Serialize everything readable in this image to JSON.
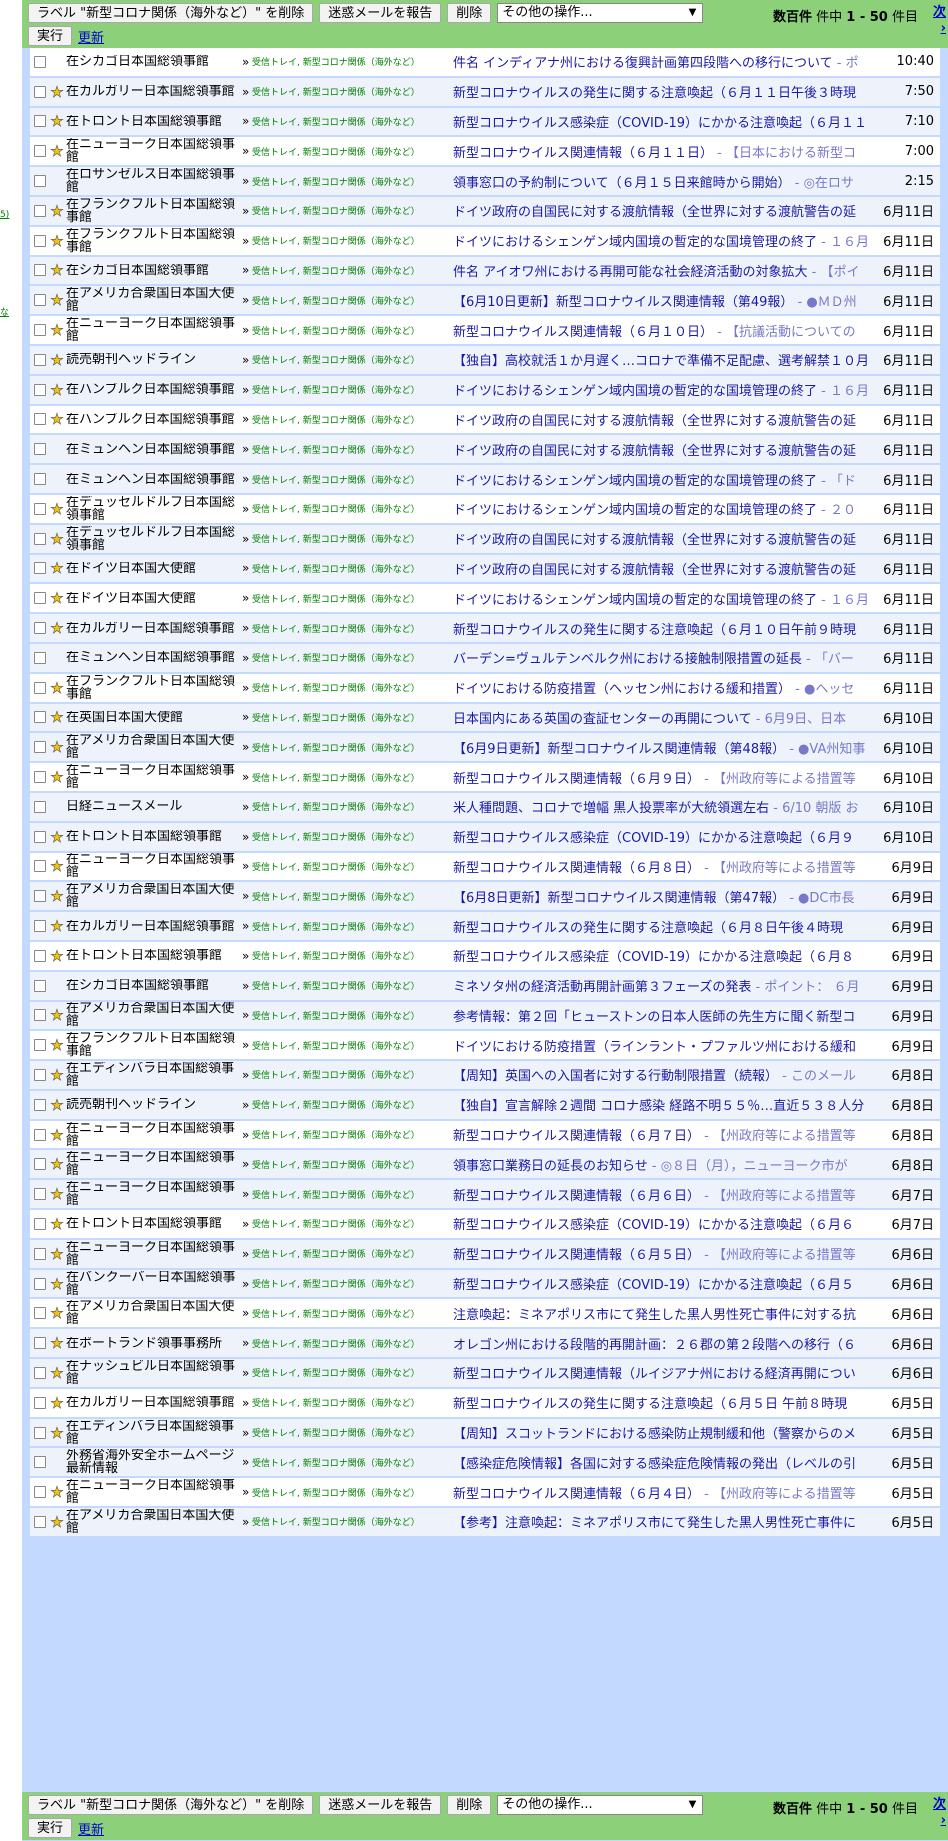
{
  "toolbar": {
    "remove_label_btn": "ラベル \"新型コロナ関係（海外など）\" を削除",
    "report_spam_btn": "迷惑メールを報告",
    "delete_btn": "削除",
    "more_actions": "その他の操作...",
    "execute_btn": "実行",
    "refresh_link": "更新",
    "count_prefix": "数百件",
    "count_mid": " 件中 ",
    "count_range": "1 - 50",
    "count_suffix": " 件目",
    "next_link": "次",
    "next_arrow": "›"
  },
  "left_fragments": [
    "5)",
    "な"
  ],
  "emails": [
    {
      "sender": "在シカゴ日本国総領事館",
      "starred": false,
      "subject": "件名 インディアナ州における復興計画第四段階への移行について",
      "snippet": " - ポ",
      "date": "10:40"
    },
    {
      "sender": "在カルガリー日本国総領事館",
      "starred": true,
      "subject": "新型コロナウイルスの発生に関する注意喚起（６月１１日午後３時現",
      "snippet": "",
      "date": "7:50"
    },
    {
      "sender": "在トロント日本国総領事館",
      "starred": true,
      "subject": "新型コロナウイルス感染症（COVID-19）にかかる注意喚起（６月１１",
      "snippet": "",
      "date": "7:10"
    },
    {
      "sender": "在ニューヨーク日本国総領事館",
      "starred": true,
      "subject": "新型コロナウイルス関連情報（６月１１日）",
      "snippet": " - 【日本における新型コ",
      "date": "7:00"
    },
    {
      "sender": "在ロサンゼルス日本国総領事館",
      "starred": false,
      "subject": "領事窓口の予約制について（６月１５日来館時から開始）",
      "snippet": " - ◎在ロサ",
      "date": "2:15"
    },
    {
      "sender": "在フランクフルト日本国総領事館",
      "starred": true,
      "subject": "ドイツ政府の自国民に対する渡航情報（全世界に対する渡航警告の延",
      "snippet": "",
      "date": "6月11日"
    },
    {
      "sender": "在フランクフルト日本国総領事館",
      "starred": true,
      "subject": "ドイツにおけるシェンゲン域内国境の暫定的な国境管理の終了",
      "snippet": " - １６月",
      "date": "6月11日"
    },
    {
      "sender": "在シカゴ日本国総領事館",
      "starred": true,
      "subject": "件名 アイオワ州における再開可能な社会経済活動の対象拡大",
      "snippet": " - 【ポイ",
      "date": "6月11日"
    },
    {
      "sender": "在アメリカ合衆国日本国大使館",
      "starred": true,
      "subject": "【6月10日更新】新型コロナウイルス関連情報（第49報）",
      "snippet": " - ●ＭＤ州",
      "date": "6月11日"
    },
    {
      "sender": "在ニューヨーク日本国総領事館",
      "starred": true,
      "subject": "新型コロナウイルス関連情報（６月１０日）",
      "snippet": " - 【抗議活動についての",
      "date": "6月11日"
    },
    {
      "sender": "読売朝刊ヘッドライン",
      "starred": true,
      "subject": "【独自】高校就活１か月遅く…コロナで準備不足配慮、選考解禁１０月",
      "snippet": "",
      "date": "6月11日"
    },
    {
      "sender": "在ハンブルク日本国総領事館",
      "starred": true,
      "subject": "ドイツにおけるシェンゲン域内国境の暫定的な国境管理の終了",
      "snippet": " - １６月",
      "date": "6月11日"
    },
    {
      "sender": "在ハンブルク日本国総領事館",
      "starred": true,
      "subject": "ドイツ政府の自国民に対する渡航情報（全世界に対する渡航警告の延",
      "snippet": "",
      "date": "6月11日"
    },
    {
      "sender": "在ミュンヘン日本国総領事館",
      "starred": false,
      "subject": "ドイツ政府の自国民に対する渡航情報（全世界に対する渡航警告の延",
      "snippet": "",
      "date": "6月11日"
    },
    {
      "sender": "在ミュンヘン日本国総領事館",
      "starred": false,
      "subject": "ドイツにおけるシェンゲン域内国境の暫定的な国境管理の終了",
      "snippet": " - 「ド",
      "date": "6月11日"
    },
    {
      "sender": "在デュッセルドルフ日本国総領事館",
      "starred": true,
      "subject": "ドイツにおけるシェンゲン域内国境の暫定的な国境管理の終了",
      "snippet": " - ２０",
      "date": "6月11日"
    },
    {
      "sender": "在デュッセルドルフ日本国総領事館",
      "starred": true,
      "subject": "ドイツ政府の自国民に対する渡航情報（全世界に対する渡航警告の延",
      "snippet": "",
      "date": "6月11日"
    },
    {
      "sender": "在ドイツ日本国大使館",
      "starred": true,
      "subject": "ドイツ政府の自国民に対する渡航情報（全世界に対する渡航警告の延",
      "snippet": "",
      "date": "6月11日"
    },
    {
      "sender": "在ドイツ日本国大使館",
      "starred": true,
      "subject": "ドイツにおけるシェンゲン域内国境の暫定的な国境管理の終了",
      "snippet": " - １６月",
      "date": "6月11日"
    },
    {
      "sender": "在カルガリー日本国総領事館",
      "starred": true,
      "subject": "新型コロナウイルスの発生に関する注意喚起（６月１０日午前９時現",
      "snippet": "",
      "date": "6月11日"
    },
    {
      "sender": "在ミュンヘン日本国総領事館",
      "starred": false,
      "subject": "バーデン=ヴュルテンベルク州における接触制限措置の延長",
      "snippet": " - 「バー",
      "date": "6月11日"
    },
    {
      "sender": "在フランクフルト日本国総領事館",
      "starred": true,
      "subject": "ドイツにおける防疫措置（ヘッセン州における緩和措置）",
      "snippet": " - ●ヘッセ",
      "date": "6月11日"
    },
    {
      "sender": "在英国日本国大使館",
      "starred": true,
      "subject": "日本国内にある英国の査証センターの再開について",
      "snippet": " - 6月9日、日本",
      "date": "6月10日"
    },
    {
      "sender": "在アメリカ合衆国日本国大使館",
      "starred": true,
      "subject": "【6月9日更新】新型コロナウイルス関連情報（第48報）",
      "snippet": " - ●VA州知事",
      "date": "6月10日"
    },
    {
      "sender": "在ニューヨーク日本国総領事館",
      "starred": true,
      "subject": "新型コロナウイルス関連情報（６月９日）",
      "snippet": " - 【州政府等による措置等",
      "date": "6月10日"
    },
    {
      "sender": "日経ニュースメール",
      "starred": false,
      "subject": "米人種問題、コロナで増幅 黒人投票率が大統領選左右",
      "snippet": " - 6/10 朝版 お",
      "date": "6月10日"
    },
    {
      "sender": "在トロント日本国総領事館",
      "starred": true,
      "subject": "新型コロナウイルス感染症（COVID-19）にかかる注意喚起（６月９",
      "snippet": "",
      "date": "6月10日"
    },
    {
      "sender": "在ニューヨーク日本国総領事館",
      "starred": true,
      "subject": "新型コロナウイルス関連情報（６月８日）",
      "snippet": " - 【州政府等による措置等",
      "date": "6月9日"
    },
    {
      "sender": "在アメリカ合衆国日本国大使館",
      "starred": true,
      "subject": "【6月8日更新】新型コロナウイルス関連情報（第47報）",
      "snippet": " - ●DC市長",
      "date": "6月9日"
    },
    {
      "sender": "在カルガリー日本国総領事館",
      "starred": true,
      "subject": "新型コロナウイルスの発生に関する注意喚起（６月８日午後４時現",
      "snippet": "",
      "date": "6月9日"
    },
    {
      "sender": "在トロント日本国総領事館",
      "starred": true,
      "subject": "新型コロナウイルス感染症（COVID-19）にかかる注意喚起（６月８",
      "snippet": "",
      "date": "6月9日"
    },
    {
      "sender": "在シカゴ日本国総領事館",
      "starred": false,
      "subject": "ミネソタ州の経済活動再開計画第３フェーズの発表",
      "snippet": " - ポイント： ６月",
      "date": "6月9日"
    },
    {
      "sender": "在アメリカ合衆国日本国大使館",
      "starred": true,
      "subject": "参考情報：第２回「ヒューストンの日本人医師の先生方に聞く新型コ",
      "snippet": "",
      "date": "6月9日"
    },
    {
      "sender": "在フランクフルト日本国総領事館",
      "starred": true,
      "subject": "ドイツにおける防疫措置（ラインラント・プファルツ州における緩和",
      "snippet": "",
      "date": "6月9日"
    },
    {
      "sender": "在エディンバラ日本国総領事館",
      "starred": true,
      "subject": "【周知】英国への入国者に対する行動制限措置（続報）",
      "snippet": " - このメール",
      "date": "6月8日"
    },
    {
      "sender": "読売朝刊ヘッドライン",
      "starred": true,
      "subject": "【独自】宣言解除２週間 コロナ感染 経路不明５５％…直近５３８人分",
      "snippet": "",
      "date": "6月8日"
    },
    {
      "sender": "在ニューヨーク日本国総領事館",
      "starred": true,
      "subject": "新型コロナウイルス関連情報（６月７日）",
      "snippet": " - 【州政府等による措置等",
      "date": "6月8日"
    },
    {
      "sender": "在ニューヨーク日本国総領事館",
      "starred": true,
      "subject": "領事窓口業務日の延長のお知らせ",
      "snippet": " - ◎８日（月），ニューヨーク市が",
      "date": "6月8日"
    },
    {
      "sender": "在ニューヨーク日本国総領事館",
      "starred": true,
      "subject": "新型コロナウイルス関連情報（６月６日）",
      "snippet": " - 【州政府等による措置等",
      "date": "6月7日"
    },
    {
      "sender": "在トロント日本国総領事館",
      "starred": true,
      "subject": "新型コロナウイルス感染症（COVID-19）にかかる注意喚起（６月６",
      "snippet": "",
      "date": "6月7日"
    },
    {
      "sender": "在ニューヨーク日本国総領事館",
      "starred": true,
      "subject": "新型コロナウイルス関連情報（６月５日）",
      "snippet": " - 【州政府等による措置等",
      "date": "6月6日"
    },
    {
      "sender": "在バンクーバー日本国総領事館",
      "starred": true,
      "subject": "新型コロナウイルス感染症（COVID-19）にかかる注意喚起（６月５",
      "snippet": "",
      "date": "6月6日"
    },
    {
      "sender": "在アメリカ合衆国日本国大使館",
      "starred": true,
      "subject": "注意喚起：ミネアポリス市にて発生した黒人男性死亡事件に対する抗",
      "snippet": "",
      "date": "6月6日"
    },
    {
      "sender": "在ポートランド領事事務所",
      "starred": true,
      "subject": "オレゴン州における段階的再開計画：２６郡の第２段階への移行（６",
      "snippet": "",
      "date": "6月6日"
    },
    {
      "sender": "在ナッシュビル日本国総領事館",
      "starred": true,
      "subject": "新型コロナウイルス関連情報（ルイジアナ州における経済再開につい",
      "snippet": "",
      "date": "6月6日"
    },
    {
      "sender": "在カルガリー日本国総領事館",
      "starred": true,
      "subject": "新型コロナウイルスの発生に関する注意喚起（６月５日 午前８時現",
      "snippet": "",
      "date": "6月5日"
    },
    {
      "sender": "在エディンバラ日本国総領事館",
      "starred": true,
      "subject": "【周知】スコットランドにおける感染防止規制緩和他（警察からのメ",
      "snippet": "",
      "date": "6月5日"
    },
    {
      "sender": "外務省海外安全ホームページ　最新情報",
      "starred": false,
      "subject": "【感染症危険情報】各国に対する感染症危険情報の発出（レベルの引",
      "snippet": "",
      "date": "6月5日"
    },
    {
      "sender": "在ニューヨーク日本国総領事館",
      "starred": true,
      "subject": "新型コロナウイルス関連情報（６月４日）",
      "snippet": " - 【州政府等による措置等",
      "date": "6月5日"
    },
    {
      "sender": "在アメリカ合衆国日本国大使館",
      "starred": true,
      "subject": "【参考】注意喚起：ミネアポリス市にて発生した黒人男性死亡事件に",
      "snippet": "",
      "date": "6月5日"
    }
  ],
  "labels_text": "受信トレイ, 新型コロナ関係（海外など）",
  "arrow_text": "»",
  "checkbox_icon": "checkbox",
  "star_icon": "star-icon",
  "colors": {
    "toolbar": "#8cd17a",
    "panel": "#c3d9ff",
    "label": "#008000",
    "subject": "#1a1aa6",
    "link": "#0000cc"
  }
}
